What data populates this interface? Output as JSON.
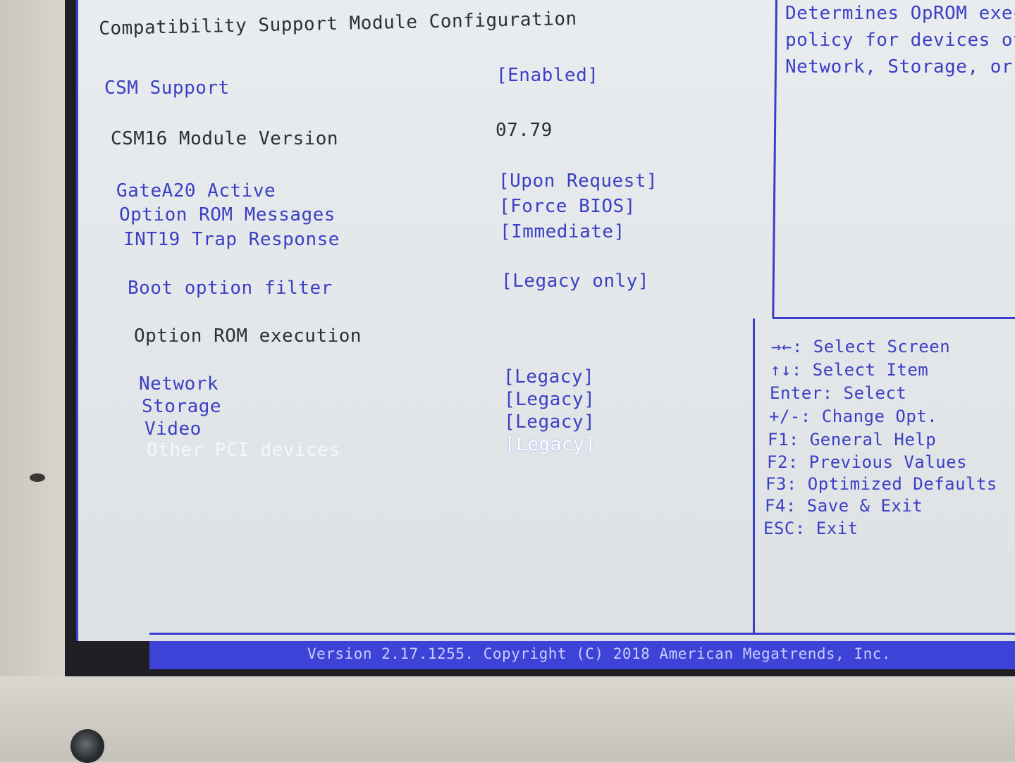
{
  "page_title": "Compatibility Support Module Configuration",
  "settings": {
    "csm_support": {
      "label": "CSM Support",
      "value": "[Enabled]"
    },
    "csm16_version": {
      "label": "CSM16 Module Version",
      "value": "07.79"
    },
    "gatea20": {
      "label": "GateA20 Active",
      "value": "[Upon Request]"
    },
    "option_rom_messages": {
      "label": "Option ROM Messages",
      "value": "[Force BIOS]"
    },
    "int19_trap": {
      "label": "INT19 Trap Response",
      "value": "[Immediate]"
    },
    "boot_option_filter": {
      "label": "Boot option filter",
      "value": "[Legacy only]"
    },
    "option_rom_execution": {
      "label": "Option ROM execution"
    },
    "network": {
      "label": "Network",
      "value": "[Legacy]"
    },
    "storage": {
      "label": "Storage",
      "value": "[Legacy]"
    },
    "video": {
      "label": "Video",
      "value": "[Legacy]"
    },
    "other_pci": {
      "label": "Other PCI devices",
      "value": "[Legacy]"
    }
  },
  "help": {
    "lines": [
      "Determines OpROM exec",
      "policy for devices ot",
      "Network, Storage, or"
    ]
  },
  "keys": [
    "→←: Select Screen",
    "↑↓: Select Item",
    "Enter: Select",
    "+/-: Change Opt.",
    "F1: General Help",
    "F2: Previous Values",
    "F3: Optimized Defaults",
    "F4: Save & Exit",
    "ESC: Exit"
  ],
  "footer": "Version 2.17.1255. Copyright (C) 2018 American Megatrends, Inc.",
  "colors": {
    "accent": "#3b3fc4",
    "frame": "#3a3ed0",
    "panel_bg": "#e5e8ea"
  }
}
